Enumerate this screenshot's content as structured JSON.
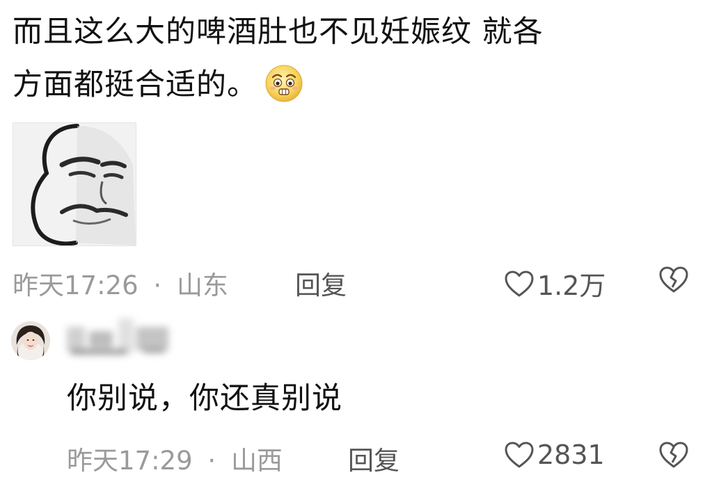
{
  "comment": {
    "line1": "而且这么大的啤酒肚也不见妊娠纹 就各",
    "line2": "方面都挺合适的。",
    "emoji_icon": "pleading-face-icon",
    "sticker_icon": "meme-face-sticker",
    "time": "昨天17:26",
    "separator": "·",
    "location": "山东",
    "reply_label": "回复",
    "likes": "1.2万"
  },
  "reply": {
    "avatar_icon": "user-avatar",
    "username_redacted": true,
    "text": "你别说，你还真别说",
    "time": "昨天17:29",
    "separator": "·",
    "location": "山西",
    "reply_label": "回复",
    "likes": "2831"
  },
  "colors": {
    "text": "#111111",
    "meta": "#9a9a9a",
    "action": "#555555"
  }
}
